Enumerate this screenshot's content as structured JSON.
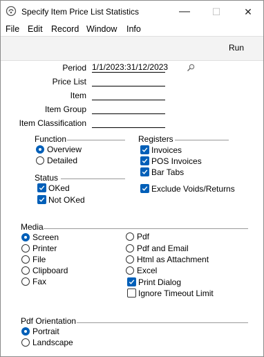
{
  "window": {
    "title": "Specify Item Price List Statistics",
    "minimize": "—",
    "maximize": "☐",
    "close": "✕"
  },
  "menu": [
    "File",
    "Edit",
    "Record",
    "Window",
    "Info"
  ],
  "toolbar": {
    "run_label": "Run"
  },
  "fields": {
    "period_label": "Period",
    "period_value": "1/1/2023:31/12/2023",
    "pricelist_label": "Price List",
    "pricelist_value": "",
    "item_label": "Item",
    "item_value": "",
    "itemgroup_label": "Item Group",
    "itemgroup_value": "",
    "itemclass_label": "Item Classification",
    "itemclass_value": ""
  },
  "function": {
    "title": "Function",
    "overview": "Overview",
    "detailed": "Detailed",
    "selected": "Overview"
  },
  "status": {
    "title": "Status",
    "oked": "OKed",
    "not_oked": "Not OKed",
    "oked_checked": true,
    "not_oked_checked": true
  },
  "registers": {
    "title": "Registers",
    "invoices": "Invoices",
    "pos_invoices": "POS Invoices",
    "bar_tabs": "Bar Tabs",
    "exclude_voids": "Exclude Voids/Returns",
    "invoices_checked": true,
    "pos_invoices_checked": true,
    "bar_tabs_checked": true,
    "exclude_voids_checked": true
  },
  "media": {
    "title": "Media",
    "screen": "Screen",
    "printer": "Printer",
    "file": "File",
    "clipboard": "Clipboard",
    "fax": "Fax",
    "pdf": "Pdf",
    "pdf_email": "Pdf and Email",
    "html_attachment": "Html as Attachment",
    "excel": "Excel",
    "print_dialog": "Print Dialog",
    "ignore_timeout": "Ignore Timeout Limit",
    "selected": "Screen",
    "print_dialog_checked": true,
    "ignore_timeout_checked": false
  },
  "pdf_orientation": {
    "title": "Pdf Orientation",
    "portrait": "Portrait",
    "landscape": "Landscape",
    "selected": "Portrait"
  },
  "colors": {
    "accent": "#005fb8",
    "toolbar_bg": "#f3f3f3"
  }
}
